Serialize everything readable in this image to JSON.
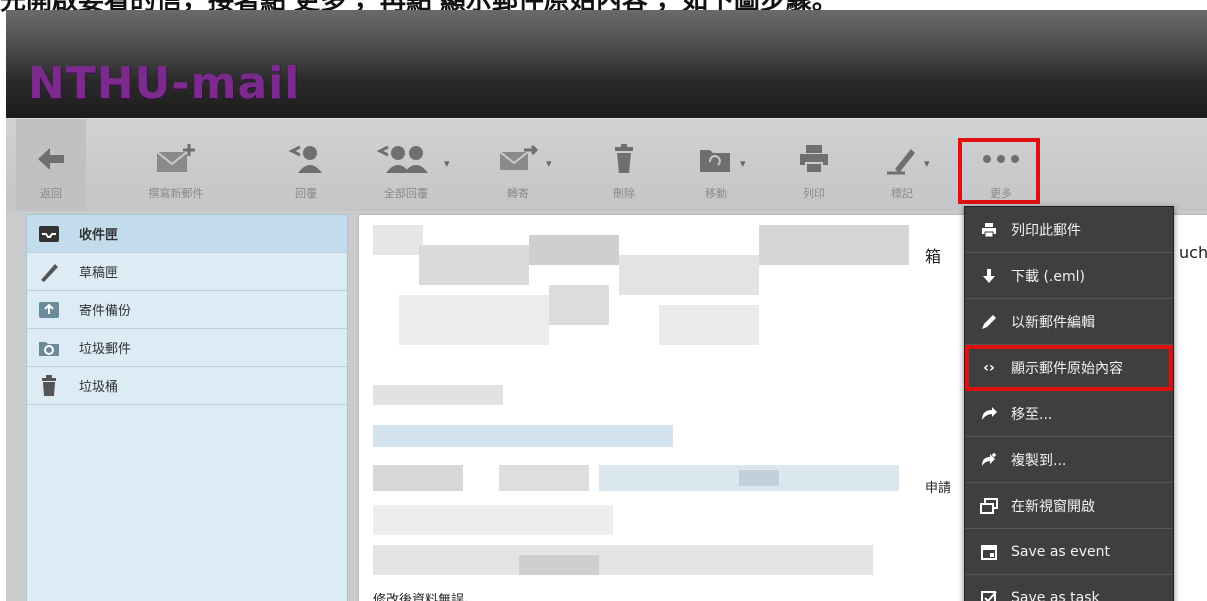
{
  "caption": "先開啟要看的信，接著點'更多'，再點'顯示郵件原始內容'，如下圖步驟。",
  "app": {
    "logo": "NTHU-mail"
  },
  "toolbar": {
    "back": "返回",
    "compose": "撰寫新郵件",
    "reply": "回覆",
    "reply_all": "全部回覆",
    "forward": "轉寄",
    "delete": "刪除",
    "move": "移動",
    "print": "列印",
    "mark": "標記",
    "more": "更多"
  },
  "sidebar": {
    "items": [
      {
        "label": "收件匣",
        "icon": "inbox-icon"
      },
      {
        "label": "草稿匣",
        "icon": "pencil-icon"
      },
      {
        "label": "寄件備份",
        "icon": "sent-icon"
      },
      {
        "label": "垃圾郵件",
        "icon": "junk-icon"
      },
      {
        "label": "垃圾桶",
        "icon": "trash-icon"
      }
    ]
  },
  "content": {
    "fragment1": "箱",
    "fragment2": "uch",
    "fragment3": "申請",
    "footer_text": "修改後資料無誤。"
  },
  "more_menu": {
    "items": [
      {
        "label": "列印此郵件",
        "icon": "printer-icon"
      },
      {
        "label": "下載 (.eml)",
        "icon": "download-icon"
      },
      {
        "label": "以新郵件編輯",
        "icon": "pencil-icon"
      },
      {
        "label": "顯示郵件原始內容",
        "icon": "code-icon",
        "highlighted": true
      },
      {
        "label": "移至...",
        "icon": "move-icon"
      },
      {
        "label": "複製到...",
        "icon": "copy-icon"
      },
      {
        "label": "在新視窗開啟",
        "icon": "new-window-icon"
      },
      {
        "label": "Save as event",
        "icon": "calendar-icon"
      },
      {
        "label": "Save as task",
        "icon": "task-icon"
      }
    ]
  },
  "colors": {
    "logo": "#7d2a8e",
    "highlight": "#e01010",
    "menu_bg": "#3f3f3f",
    "sidebar_bg": "#dcebf4"
  }
}
